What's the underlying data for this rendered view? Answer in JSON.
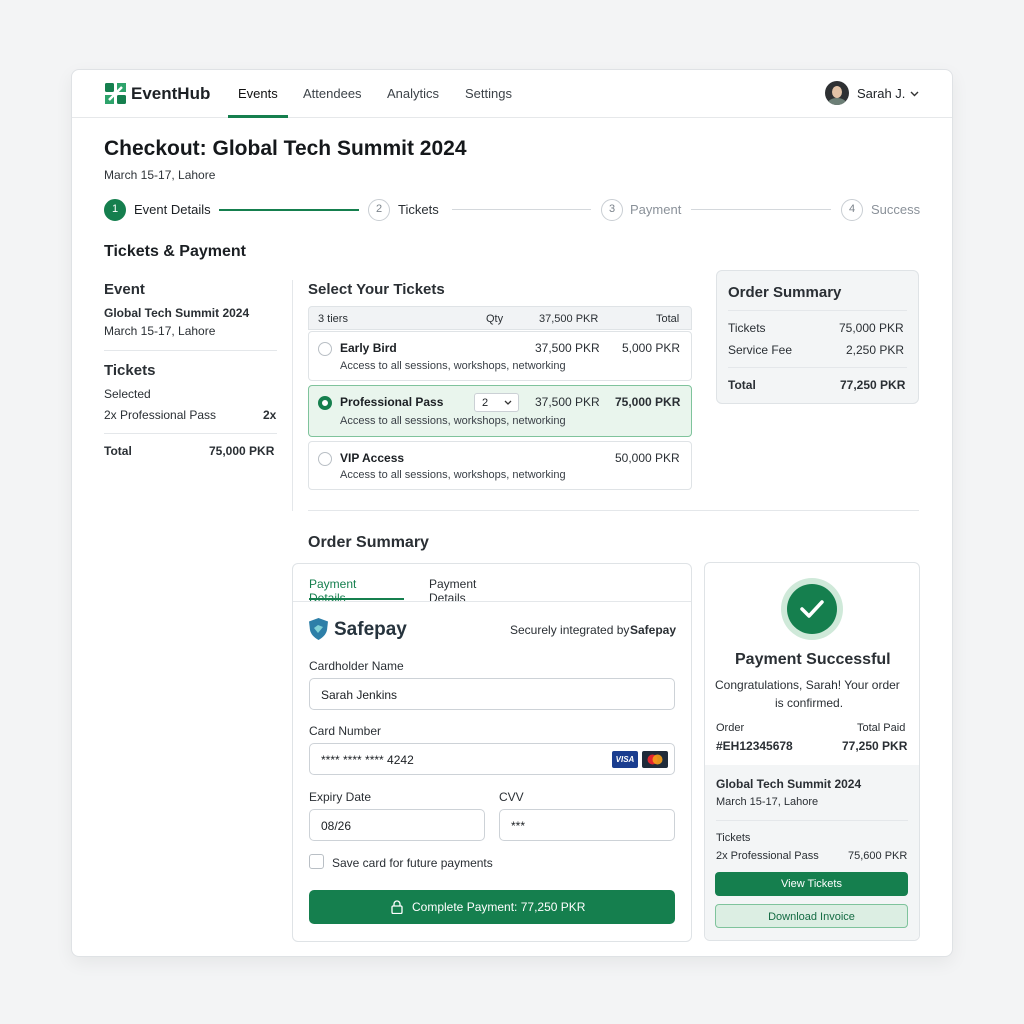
{
  "app": {
    "brand": "EventHub",
    "user_name": "Sarah J."
  },
  "nav": [
    "Events",
    "Attendees",
    "Analytics",
    "Settings"
  ],
  "page": {
    "title": "Checkout: Global Tech Summit 2024",
    "subtitle": "March 15-17, Lahore"
  },
  "steps": [
    {
      "num": "1",
      "label": "Event Details",
      "active": true
    },
    {
      "num": "2",
      "label": "Tickets"
    },
    {
      "num": "3",
      "label": "Payment"
    },
    {
      "num": "4",
      "label": "Success"
    }
  ],
  "section_title": "Tickets & Payment",
  "left_panel": {
    "event_heading": "Event",
    "event_name": "Global Tech Summit 2024",
    "event_date": "March 15-17, Lahore",
    "tickets_heading": "Tickets",
    "selected_label": "Selected",
    "selected_item": "2x Professional Pass",
    "selected_qty": "2x",
    "total_label": "Total",
    "total_value": "75,000 PKR"
  },
  "tickets": {
    "heading": "Select Your Tickets",
    "table_header": {
      "tiers": "3 tiers",
      "qty": "Qty",
      "price": "37,500 PKR",
      "total": "Total"
    },
    "rows": [
      {
        "name": "Early Bird",
        "desc": "Access to all sessions, workshops, networking",
        "price": "37,500 PKR",
        "total": "5,000 PKR",
        "selected": false
      },
      {
        "name": "Professional Pass",
        "desc": "Access to all sessions, workshops, networking",
        "qty": "2",
        "price": "37,500 PKR",
        "total": "75,000 PKR",
        "selected": true
      },
      {
        "name": "VIP Access",
        "desc": "Access to all sessions, workshops, networking",
        "total": "50,000 PKR",
        "selected": false
      }
    ]
  },
  "order_summary_card": {
    "title": "Order Summary",
    "tickets_label": "Tickets",
    "tickets_value": "75,000 PKR",
    "fee_label": "Service Fee",
    "fee_value": "2,250 PKR",
    "total_label": "Total",
    "total_value": "77,250 PKR"
  },
  "order_summary_heading": "Order Summary",
  "payment": {
    "tabs": [
      "Payment Details",
      "Payment Details"
    ],
    "provider": "Safepay",
    "secure_prefix": "Securely integrated by",
    "secure_brand": "Safepay",
    "cardholder_label": "Cardholder Name",
    "cardholder_value": "Sarah Jenkins",
    "card_number_label": "Card Number",
    "card_number_value": "**** **** **** 4242",
    "visa_label": "VISA",
    "expiry_label": "Expiry Date",
    "expiry_value": "08/26",
    "cvv_label": "CVV",
    "cvv_value": "***",
    "save_card_label": "Save card for future payments",
    "pay_button": "Complete Payment: 77,250 PKR"
  },
  "success": {
    "title": "Payment Successful",
    "message_1": "Congratulations, Sarah! Your order",
    "message_2": "is confirmed.",
    "order_label": "Order",
    "order_value": "#EH12345678",
    "paid_label": "Total Paid",
    "paid_value": "77,250 PKR",
    "event_name": "Global Tech Summit 2024",
    "event_date": "March 15-17, Lahore",
    "tickets_label": "Tickets",
    "tickets_item": "2x Professional Pass",
    "tickets_value": "75,600 PKR",
    "view_button": "View Tickets",
    "download_button": "Download Invoice"
  },
  "colors": {
    "accent": "#157f4e",
    "accent_light": "#e9f5ed",
    "border": "#dfe3e6"
  }
}
